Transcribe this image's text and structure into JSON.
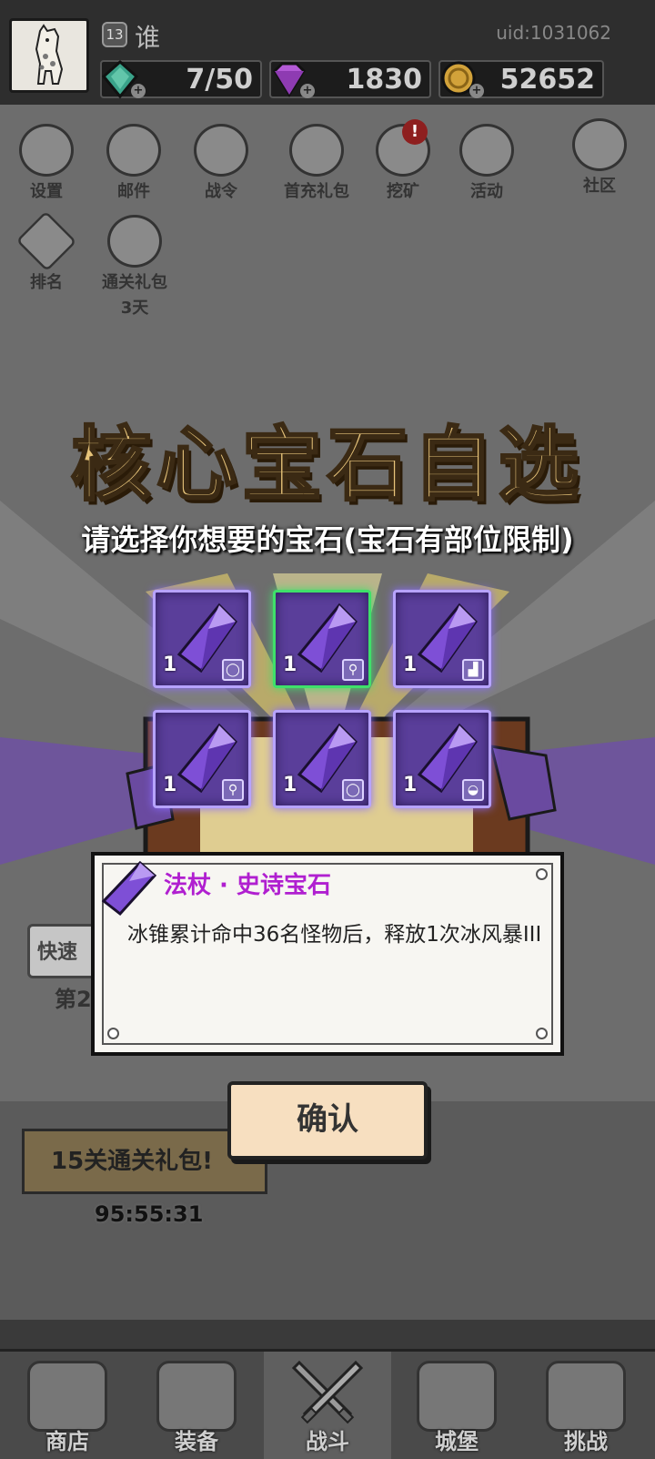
{
  "player": {
    "level": "13",
    "name": "谁",
    "uid": "uid:1031062"
  },
  "resources": [
    {
      "name": "stamina",
      "icon": "green-gem-icon",
      "value": "7/50",
      "color": "#3aa38a"
    },
    {
      "name": "diamonds",
      "icon": "purple-diamond-icon",
      "value": "1830",
      "color": "#b35ad6"
    },
    {
      "name": "gold",
      "icon": "gold-coin-icon",
      "value": "52652",
      "color": "#d2a23a"
    }
  ],
  "top_menu": [
    {
      "label": "设置",
      "icon": "gear-icon"
    },
    {
      "label": "邮件",
      "icon": "envelope-icon"
    },
    {
      "label": "战令",
      "icon": "battle-pass-icon"
    },
    {
      "label": "首充礼包",
      "icon": "money-bag-icon"
    },
    {
      "label": "挖矿",
      "icon": "mining-icon",
      "alert": "!"
    },
    {
      "label": "活动",
      "icon": "activity-icon"
    },
    {
      "label": "社区",
      "icon": "home-bubble-icon"
    }
  ],
  "top_menu_row2": [
    {
      "label": "排名",
      "icon": "ranking-icon"
    },
    {
      "label": "通关礼包",
      "sublabel": "3天",
      "icon": "gift-sack-icon"
    }
  ],
  "background": {
    "quick_btn": "快速",
    "stage": "第2",
    "bundle_title": "15关通关礼包!",
    "bundle_timer": "95:55:31"
  },
  "popup": {
    "title": "核心宝石自选",
    "subtitle": "请选择你想要的宝石(宝石有部位限制)",
    "gems": [
      {
        "qty": "1",
        "slot_icon": "necklace-icon",
        "glyph": "◯"
      },
      {
        "qty": "1",
        "slot_icon": "staff-icon",
        "glyph": "⚲",
        "selected": true
      },
      {
        "qty": "1",
        "slot_icon": "boots-icon",
        "glyph": "▟"
      },
      {
        "qty": "1",
        "slot_icon": "staff-icon",
        "glyph": "⚲"
      },
      {
        "qty": "1",
        "slot_icon": "necklace-icon",
        "glyph": "◯"
      },
      {
        "qty": "1",
        "slot_icon": "helmet-icon",
        "glyph": "◒"
      }
    ],
    "selected_name": "法杖 · 史诗宝石",
    "selected_desc": "冰锥累计命中36名怪物后，释放1次冰风暴III",
    "confirm": "确认"
  },
  "bottom_nav": [
    {
      "label": "商店",
      "icon": "shop-icon"
    },
    {
      "label": "装备",
      "icon": "backpack-icon"
    },
    {
      "label": "战斗",
      "icon": "crossed-swords-icon",
      "active": true
    },
    {
      "label": "城堡",
      "icon": "castle-icon"
    },
    {
      "label": "挑战",
      "icon": "challenge-shield-icon"
    }
  ],
  "colors": {
    "title_gold": "#e7c47a",
    "epic_purple": "#b01fd0",
    "selected_green": "#3fe06a"
  }
}
